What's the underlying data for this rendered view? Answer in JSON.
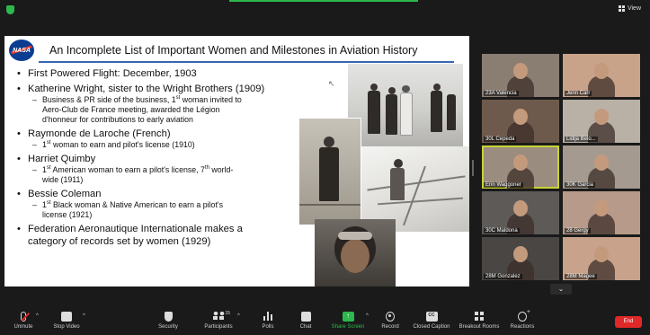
{
  "view": {
    "label": "View"
  },
  "slide": {
    "logo_text": "NASA",
    "title": "An Incomplete List of Important Women and Milestones in Aviation History",
    "b1": "First Powered Flight: December, 1903",
    "b2": "Katherine Wright, sister to the Wright Brothers (1909)",
    "b2s_1": "Business & PR side of the business, 1",
    "b2s_sup": "st",
    "b2s_2": " woman invited to",
    "b2s_3": "Aero-Club de France meeting, awarded the Légion",
    "b2s_4": "d'honneur for contributions to early aviation",
    "b3": "Raymonde de Laroche (French)",
    "b3s_1": "1",
    "b3s_sup": "st",
    "b3s_2": " woman to earn and pilot's license (1910)",
    "b4": "Harriet Quimby",
    "b4s_1": "1",
    "b4s_sup1": "st",
    "b4s_2": " American woman to earn a pilot's license, 7",
    "b4s_sup2": "th",
    "b4s_3": " world-",
    "b4s_4": "wide (1911)",
    "b5": "Bessie Coleman",
    "b5s_1": "1",
    "b5s_sup": "st",
    "b5s_2": " Black woman & Native American to earn a pilot's",
    "b5s_3": "license (1921)",
    "b6_1": "Federation Aeronautique Internationale makes a",
    "b6_2": "category of records set by women (1929)"
  },
  "gallery": {
    "participants": [
      {
        "name": "23A Valencia",
        "bg": "#8a7d72"
      },
      {
        "name": "Jenn Carr",
        "bg": "#c9a28a"
      },
      {
        "name": "30L Cepeda",
        "bg": "#6e5a4c"
      },
      {
        "name": "Lidija Belo...",
        "bg": "#b9b0a6"
      },
      {
        "name": "Erin Waggoner",
        "bg": "#9a8c7e"
      },
      {
        "name": "30K Garcia",
        "bg": "#a49a8f"
      },
      {
        "name": "30C Maldona",
        "bg": "#5d5a58"
      },
      {
        "name": "28 Gergy",
        "bg": "#b79a8a"
      },
      {
        "name": "28M Gonzalez",
        "bg": "#4a4644"
      },
      {
        "name": "28M Magee",
        "bg": "#c8a28a"
      }
    ],
    "down_arrow": "⌄"
  },
  "toolbar": {
    "unmute": "Unmute",
    "stop_video": "Stop Video",
    "security": "Security",
    "participants": "Participants",
    "participants_count": "15",
    "polls": "Polls",
    "chat": "Chat",
    "share_screen": "Share Screen",
    "record": "Record",
    "closed_caption": "Closed Caption",
    "cc_glyph": "CC",
    "breakout_rooms": "Breakout Rooms",
    "reactions": "Reactions",
    "end": "End",
    "caret": "^"
  }
}
